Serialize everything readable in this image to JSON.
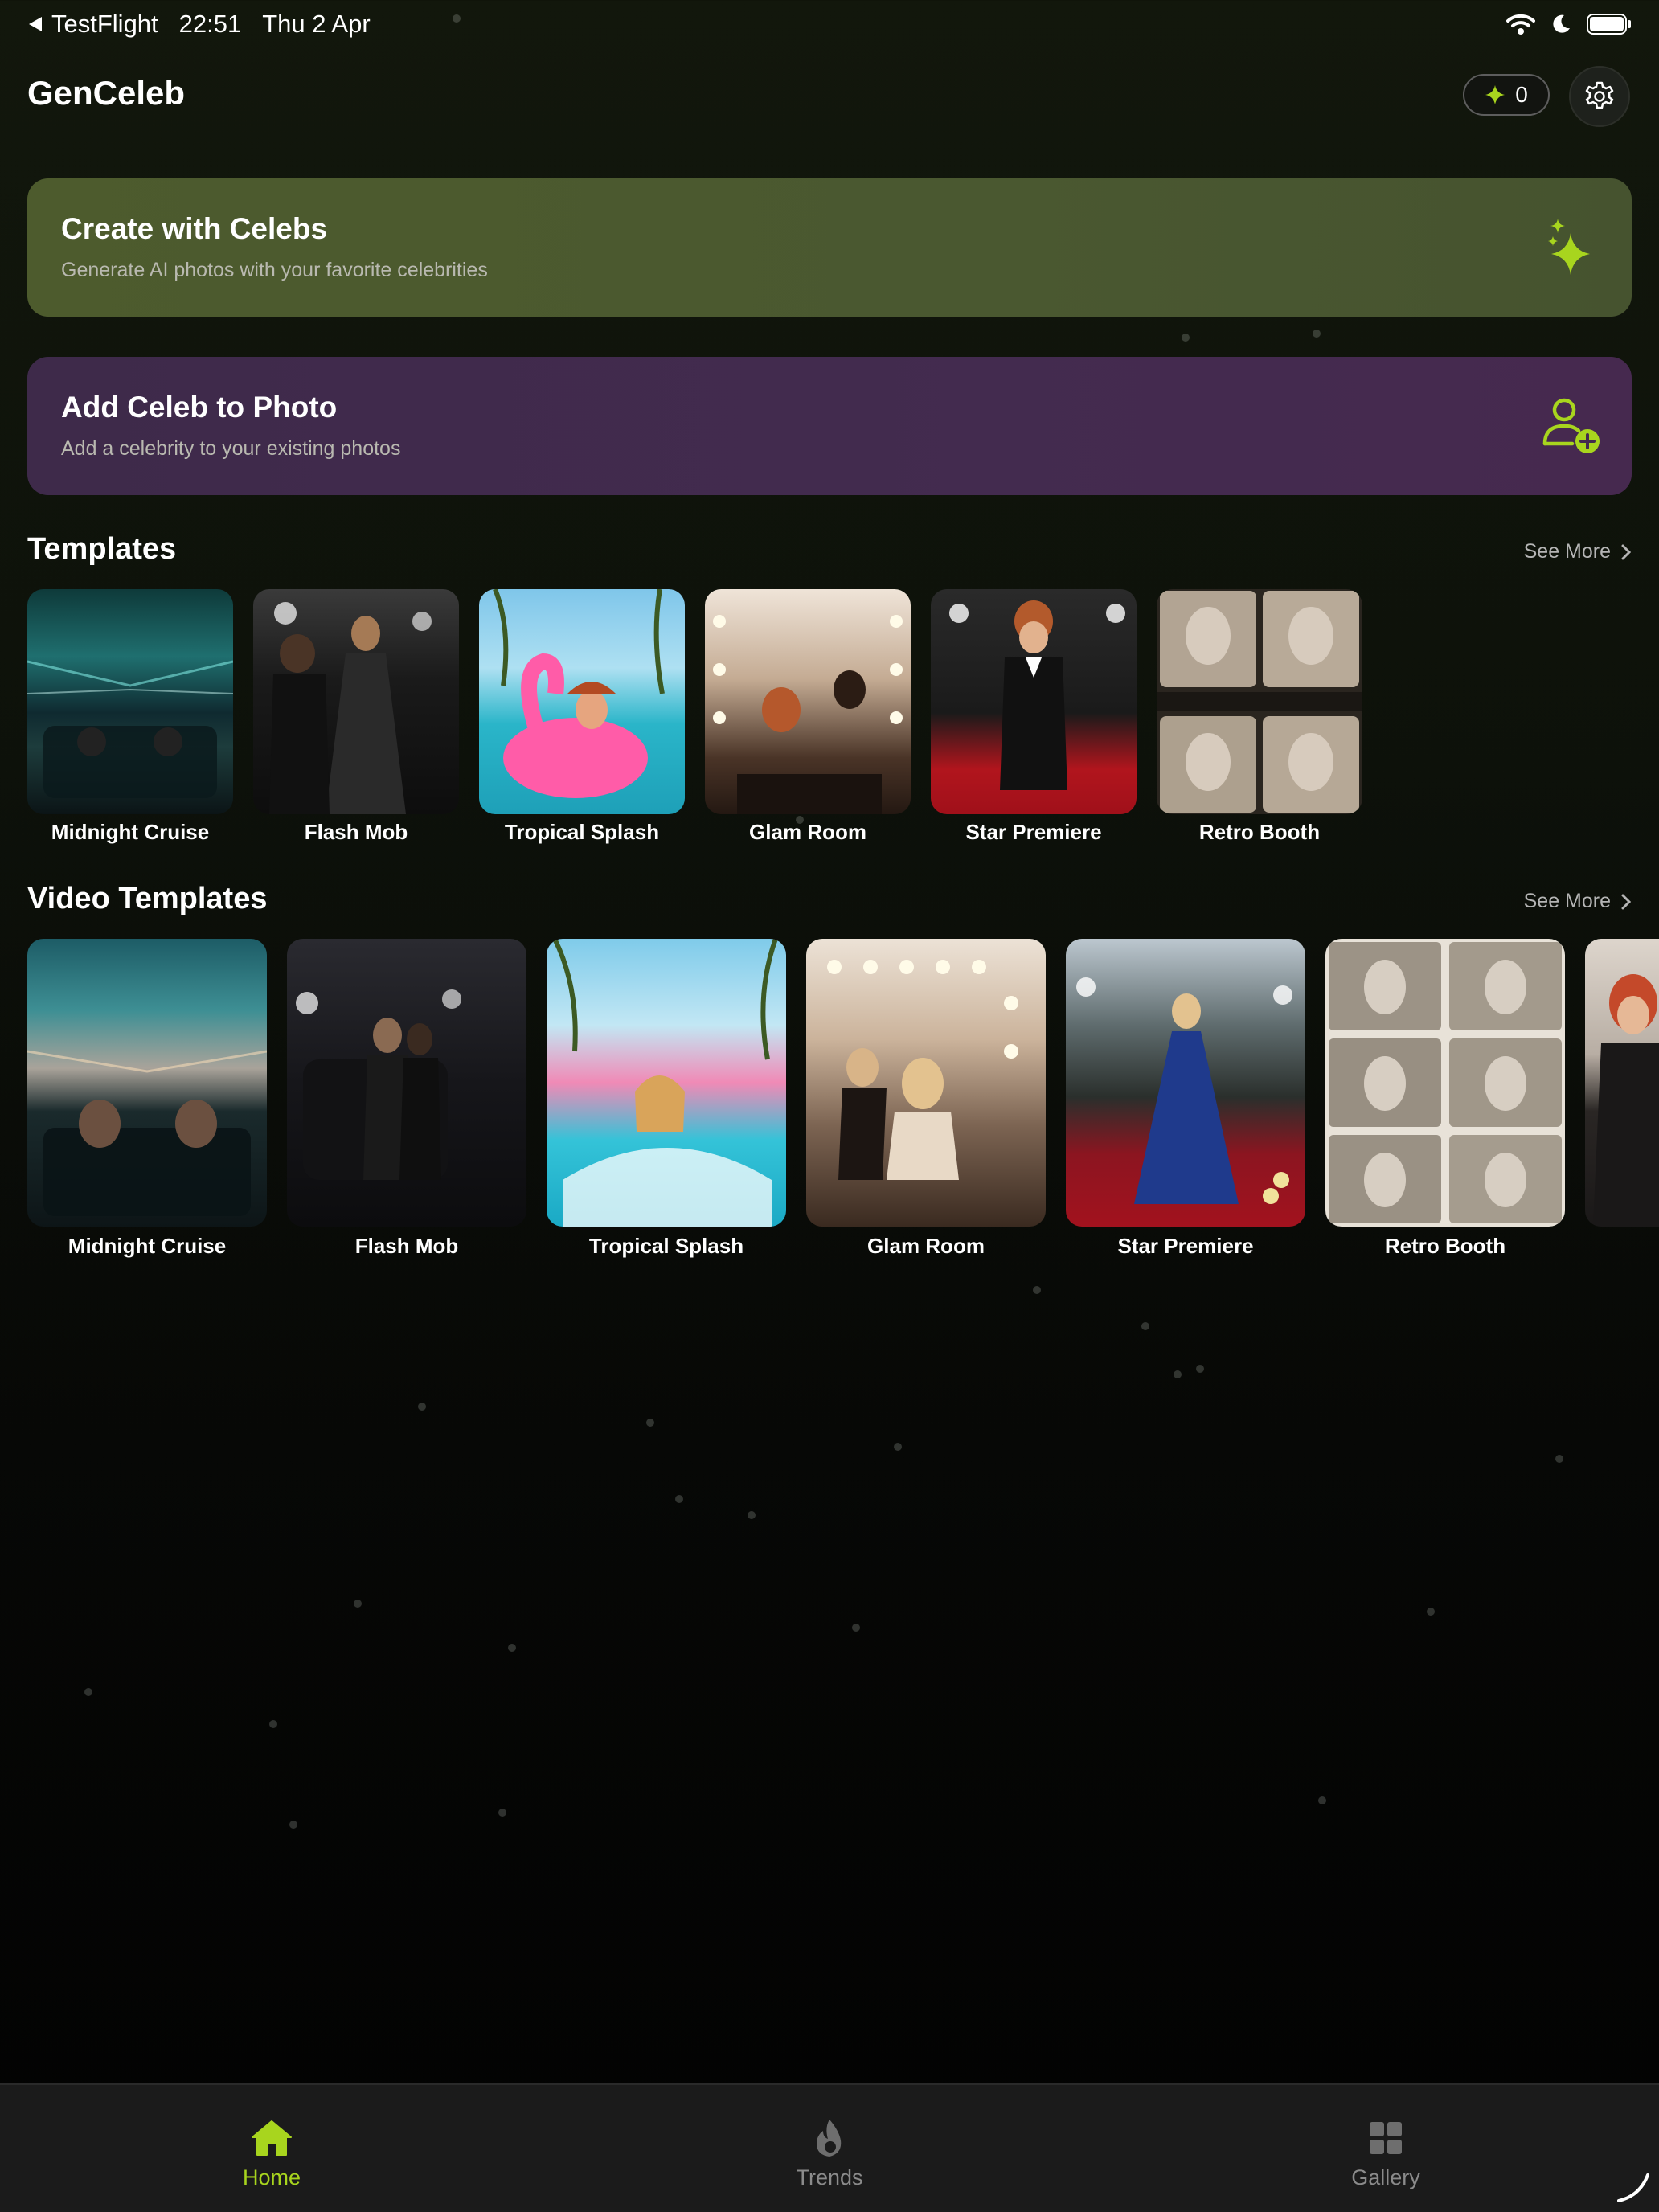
{
  "status_bar": {
    "back_app": "TestFlight",
    "time": "22:51",
    "date": "Thu 2 Apr"
  },
  "header": {
    "app_title": "GenCeleb",
    "credits": "0"
  },
  "cards": {
    "create": {
      "title": "Create with Celebs",
      "subtitle": "Generate AI photos with your favorite celebrities",
      "icon": "sparkles-icon"
    },
    "add": {
      "title": "Add Celeb to Photo",
      "subtitle": "Add a celebrity to your existing photos",
      "icon": "add-person-icon"
    }
  },
  "templates": {
    "title": "Templates",
    "see_more": "See More",
    "items": [
      {
        "label": "Midnight Cruise"
      },
      {
        "label": "Flash Mob"
      },
      {
        "label": "Tropical Splash"
      },
      {
        "label": "Glam Room"
      },
      {
        "label": "Star Premiere"
      },
      {
        "label": "Retro Booth"
      }
    ]
  },
  "video_templates": {
    "title": "Video Templates",
    "see_more": "See More",
    "items": [
      {
        "label": "Midnight Cruise"
      },
      {
        "label": "Flash Mob"
      },
      {
        "label": "Tropical Splash"
      },
      {
        "label": "Glam Room"
      },
      {
        "label": "Star Premiere"
      },
      {
        "label": "Retro Booth"
      }
    ]
  },
  "nav": {
    "home": "Home",
    "trends": "Trends",
    "gallery": "Gallery"
  },
  "colors": {
    "accent": "#a8d51e",
    "create_card": "#4d5b2d",
    "add_card": "#432b4f",
    "nav_bg": "#1b1b1b"
  }
}
